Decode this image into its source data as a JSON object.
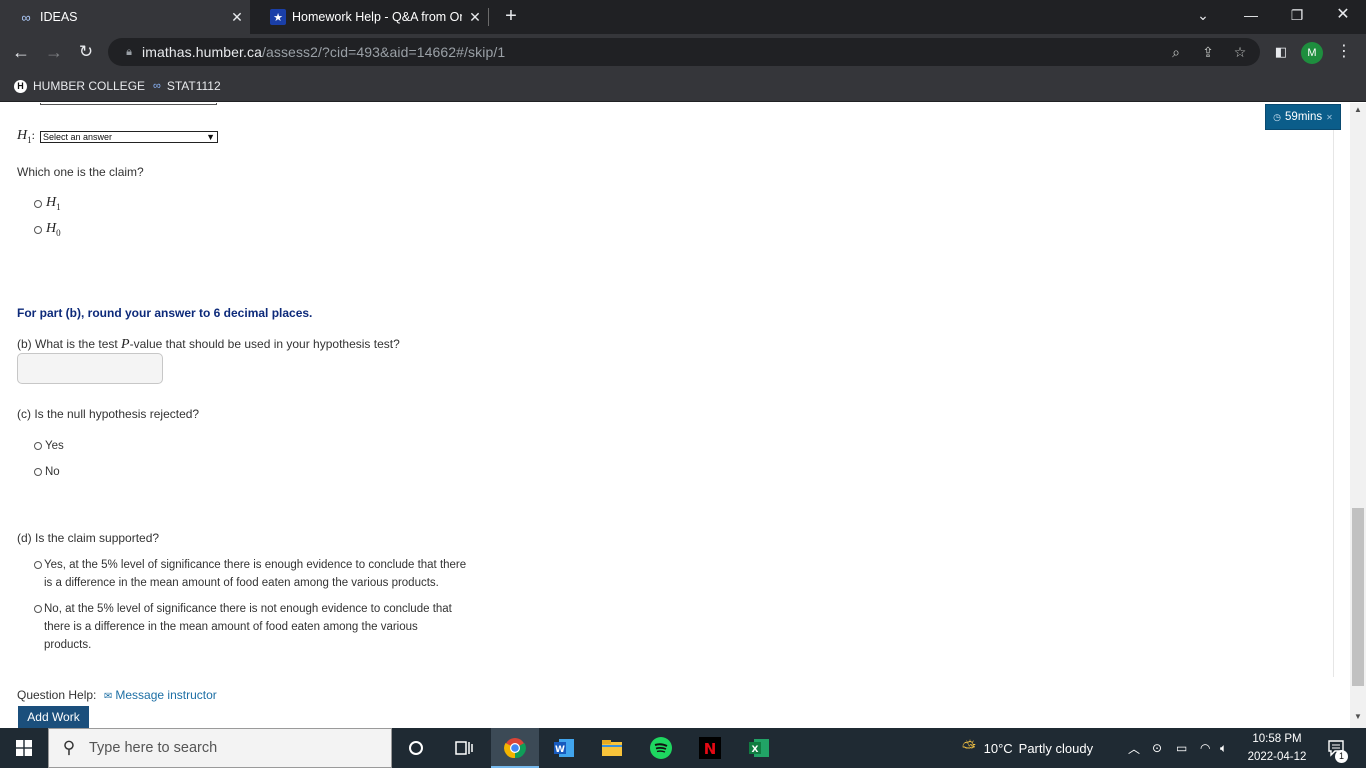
{
  "browser": {
    "tabs": [
      {
        "title": "IDEAS",
        "icon": "infinity-icon",
        "active": true
      },
      {
        "title": "Homework Help - Q&A from Onl",
        "icon": "star-icon",
        "active": false
      }
    ],
    "close_glyph": "✕",
    "new_tab_glyph": "+",
    "url_host": "imathas.humber.ca",
    "url_path": "/assess2/?cid=493&aid=14662#/skip/1",
    "profile_initial": "M",
    "bookmarks": [
      {
        "label": "HUMBER COLLEGE",
        "icon": "humber-logo-icon"
      },
      {
        "label": "STAT1112",
        "icon": "infinity-icon"
      }
    ]
  },
  "question": {
    "h1_symbol": "H",
    "h1_sub": "1",
    "h_colon": ":",
    "select_placeholder": "Select an answer",
    "claim_prompt": "Which one is the claim?",
    "claim_options": [
      {
        "symbol": "H",
        "sub": "1"
      },
      {
        "symbol": "H",
        "sub": "0"
      }
    ],
    "part_b_note": "For part (b), round your answer to 6 decimal places.",
    "part_b_prefix": "(b) What is the test ",
    "part_b_var": "P",
    "part_b_suffix": "-value that should be used in your hypothesis test?",
    "part_b_value": "",
    "part_c_prompt": "(c) Is the null hypothesis rejected?",
    "part_c_options": [
      "Yes",
      "No"
    ],
    "part_d_prompt": "(d) Is the claim supported?",
    "part_d_options": [
      {
        "line1": "Yes, at the 5% level of significance there is enough evidence to conclude that there",
        "line2": "is a difference in the mean amount of food eaten among the various products.",
        "line3": ""
      },
      {
        "line1": "No, at the 5% level of significance there is not enough evidence to conclude that",
        "line2": "there is a difference in the mean amount of food eaten among the various",
        "line3": "products."
      }
    ],
    "help_label": "Question Help:",
    "message_instructor": "Message instructor",
    "add_work": "Add Work",
    "timer": "59mins"
  },
  "taskbar": {
    "search_placeholder": "Type here to search",
    "weather_temp": "10°C",
    "weather_desc": "Partly cloudy",
    "time": "10:58 PM",
    "date": "2022-04-12",
    "notif_count": "1",
    "apps": [
      "task-view",
      "chrome",
      "word",
      "file-explorer",
      "spotify",
      "netflix",
      "excel"
    ]
  },
  "colors": {
    "accent_blue": "#0d2a7a",
    "timer_bg": "#0b5d8a",
    "link": "#1d6fa5",
    "add_work_bg": "#1b4f7c"
  }
}
